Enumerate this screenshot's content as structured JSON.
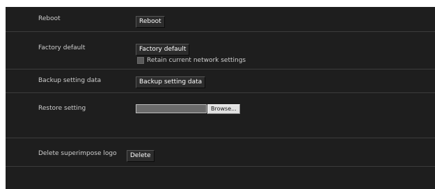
{
  "settings": {
    "reboot": {
      "label": "Reboot",
      "button": "Reboot"
    },
    "factory_default": {
      "label": "Factory default",
      "button": "Factory default",
      "retain_checkbox_label": "Retain current network settings",
      "retain_checked": false
    },
    "backup": {
      "label": "Backup setting data",
      "button": "Backup setting data"
    },
    "restore": {
      "label": "Restore setting",
      "file_value": "",
      "browse_button": "Browse..."
    },
    "delete_logo": {
      "label": "Delete superimpose logo",
      "button": "Delete"
    }
  },
  "colors": {
    "panel_background": "#1e1e1e",
    "divider": "#3c3c3c",
    "label_text": "#cfcfcf",
    "button_text": "#ffffff"
  }
}
